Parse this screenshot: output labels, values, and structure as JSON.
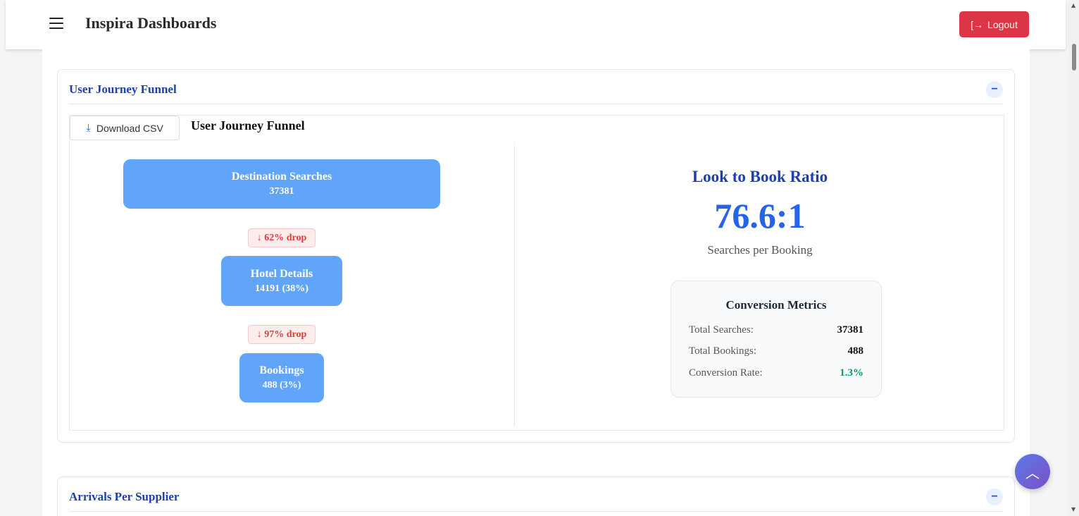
{
  "header": {
    "title": "Inspira Dashboards",
    "logout_label": "Logout",
    "menu_icon": "hamburger-icon",
    "logout_icon": "logout-icon"
  },
  "funnel_card": {
    "title": "User Journey Funnel",
    "collapse_symbol": "−",
    "download_label": "Download CSV",
    "chart_title": "User Journey Funnel",
    "stages": [
      {
        "name": "Destination Searches",
        "value": "37381"
      },
      {
        "name": "Hotel Details",
        "value": "14191 (38%)"
      },
      {
        "name": "Bookings",
        "value": "488 (3%)"
      }
    ],
    "drops": [
      "↓ 62% drop",
      "↓ 97% drop"
    ],
    "ratio": {
      "title": "Look to Book Ratio",
      "value": "76.6:1",
      "subtitle": "Searches per Booking"
    },
    "metrics": {
      "title": "Conversion Metrics",
      "rows": [
        {
          "label": "Total Searches:",
          "value": "37381"
        },
        {
          "label": "Total Bookings:",
          "value": "488"
        },
        {
          "label": "Conversion Rate:",
          "value": "1.3%"
        }
      ]
    }
  },
  "arrivals_card": {
    "title": "Arrivals Per Supplier",
    "collapse_symbol": "−"
  },
  "colors": {
    "accent": "#1e40af",
    "stage": "#60a5fa",
    "logout": "#dc3545",
    "positive": "#059669",
    "drop": "#e03b3b"
  }
}
